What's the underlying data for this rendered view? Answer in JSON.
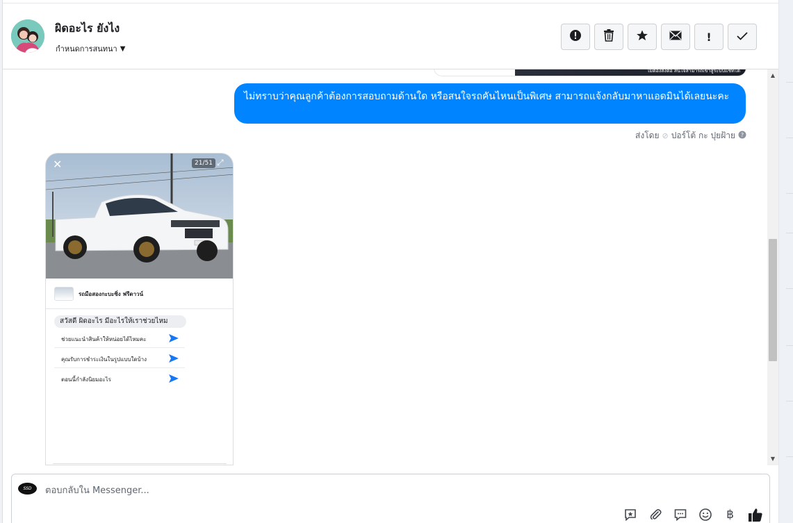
{
  "header": {
    "contact_name": "ผิดอะไร ยังไง",
    "assign_label": "กำหนดการสนทนา",
    "toolbar": {
      "spam": "!",
      "trash": "trash",
      "star": "star",
      "mail": "mail",
      "important": "!",
      "done": "✓"
    }
  },
  "conversation": {
    "previous_card_text": "ไม่ต้องส่งต่อ สนใจสามารถเข้าสู่ระบบแชทได้",
    "outgoing_message": "ไม่ทราบว่าคุณลูกค้าต้องการสอบถามด้านใด หรือสนใจรถคันไหนเป็นพิเศษ สามารถแจ้งกลับมาหาแอดมินได้เลยนะคะ",
    "sent_by_label": "ส่งโดย",
    "sender_name": "ปอร์โต้ กะ ปุยฝ้าย",
    "image_message": {
      "photo_counter": "21/51",
      "shop_name": "รถมือสองกะบะซิ่ง ฟรีดาวน์",
      "greeting": "สวัสดี ผิดอะไร มีอะไรให้เราช่วยไหม",
      "quick_replies": [
        "ช่วยแนะนำสินค้าให้หน่อยได้ไหมคะ",
        "คุณรับการชำระเงินในรูปแบบใดบ้าง",
        "ตอนนี้กำลังนิยมอะไร"
      ]
    }
  },
  "composer": {
    "placeholder": "ตอบกลับใน Messenger...",
    "avatar_text": "SSD",
    "baht_symbol": "฿"
  },
  "colors": {
    "accent": "#0084ff",
    "border": "#ccd0d5"
  }
}
